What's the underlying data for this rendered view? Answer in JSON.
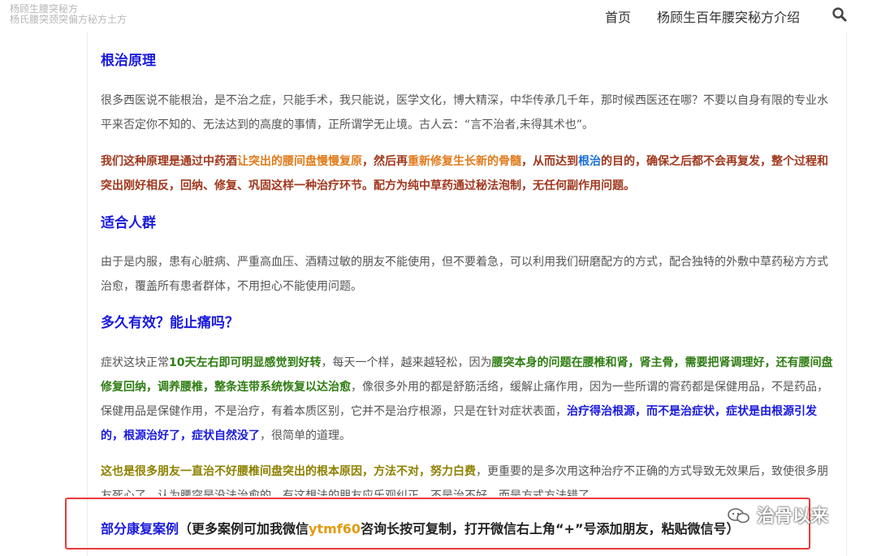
{
  "header": {
    "brand_line1": "杨顾生腰突秘方",
    "brand_line2": "杨氏腰突颈突偏方秘方土方",
    "nav_home": "首页",
    "nav_intro": "杨顾生百年腰突秘方介绍",
    "search_icon": "search-icon"
  },
  "sections": {
    "principle": {
      "heading": "根治原理",
      "para1": "很多西医说不能根治，是不治之症，只能手术，我只能说，医学文化，博大精深，中华传承几千年，那时候西医还在哪？不要以自身有限的专业水平来否定你不知的、无法达到的高度的事情，正所谓学无止境。古人云：“言不治者,未得其术也”。",
      "p2_a": "我们这种原理是通过中药酒",
      "p2_b": "让突出的腰间盘慢慢复原",
      "p2_c": "，然后再",
      "p2_d": "重新修复生长新的骨髓",
      "p2_e": "，从而达到",
      "p2_f": "根治",
      "p2_g": "的目的，确保之后都不会再复发，整个过程和突出刚好相反，回纳、修复、巩固这样一种治疗环节。配方为纯中草药通过秘法泡制，无任何副作用问题。"
    },
    "suitable": {
      "heading": "适合人群",
      "para": "由于是内服，患有心脏病、严重高血压、酒精过敏的朋友不能使用，但不要着急，可以利用我们研磨配方的方式，配合独特的外敷中草药秘方方式治愈，覆盖所有患者群体，不用担心不能使用问题。"
    },
    "effect": {
      "heading": "多久有效？能止痛吗？",
      "e_a": "症状这块正常",
      "e_b": "10天左右即可明显感觉到好转",
      "e_c": "，每天一个样，越来越轻松，因为",
      "e_d": "腰突本身的问题在腰椎和肾，肾主骨，需要把肾调理好，还有腰间盘修复回纳，调养腰椎，整条连带系统恢复以达治愈",
      "e_e": "，像很多外用的都是舒筋活络，缓解止痛作用，因为一些所谓的膏药都是保健用品，不是药品，保健用品是保健作用，不是治疗，有着本质区别，它并不是治疗根源，只是在针对症状表面，",
      "e_f": "治疗得治根源，而不是治症状，症状是由根源引发的，根源治好了，症状自然没了",
      "e_g": "，很简单的道理。",
      "f_a": "这也是很多朋友一直治不好腰椎间盘突出的根本原因，方法不对，努力白费",
      "f_b": "，更重要的是多次用这种治疗不正确的方式导致无效果后，致使很多朋友死心了，认为腰突是没法治愈的，有这想法的朋友应乐观纠正，不是治不好，而是方式方法错了。"
    },
    "cases": {
      "heading": "部分康复案例",
      "note_a": "（更多案例可加我微信",
      "wechat": "ytmf60",
      "note_b": "咨询长按可复制，打开微信右上角“+”号添加朋友，粘贴微信号）"
    }
  },
  "watermark": {
    "text": "治骨以来",
    "icon": "wechat-icon"
  },
  "colors": {
    "heading": "#1a1add",
    "highlight_red": "#a0371d",
    "highlight_orange": "#e07b1b",
    "highlight_green": "#2e7d12",
    "box_border": "#e83a3a"
  }
}
